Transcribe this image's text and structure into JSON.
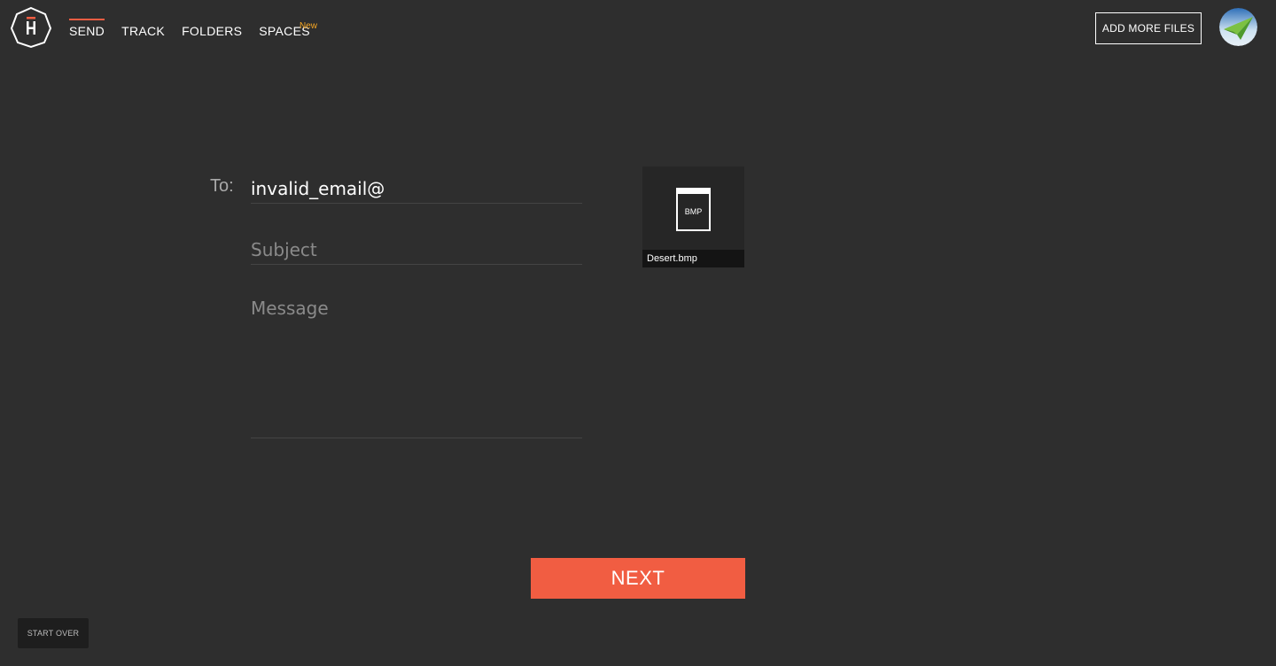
{
  "nav": {
    "items": [
      {
        "label": "SEND",
        "active": true
      },
      {
        "label": "TRACK",
        "active": false
      },
      {
        "label": "FOLDERS",
        "active": false
      },
      {
        "label": "SPACES",
        "active": false
      }
    ],
    "new_badge": "New"
  },
  "header": {
    "add_files_label": "ADD MORE FILES"
  },
  "form": {
    "to_label": "To:",
    "to_value": "invalid_email@",
    "subject_placeholder": "Subject",
    "message_placeholder": "Message"
  },
  "file": {
    "type": "BMP",
    "name": "Desert.bmp"
  },
  "actions": {
    "next_label": "NEXT",
    "start_over_label": "START OVER"
  },
  "colors": {
    "background": "#2e2e2e",
    "accent": "#f15d42",
    "badge": "#f5a623"
  },
  "icons": {
    "logo": "hightail-logo-icon",
    "file": "file-icon",
    "avatar": "paper-plane-avatar-icon"
  }
}
